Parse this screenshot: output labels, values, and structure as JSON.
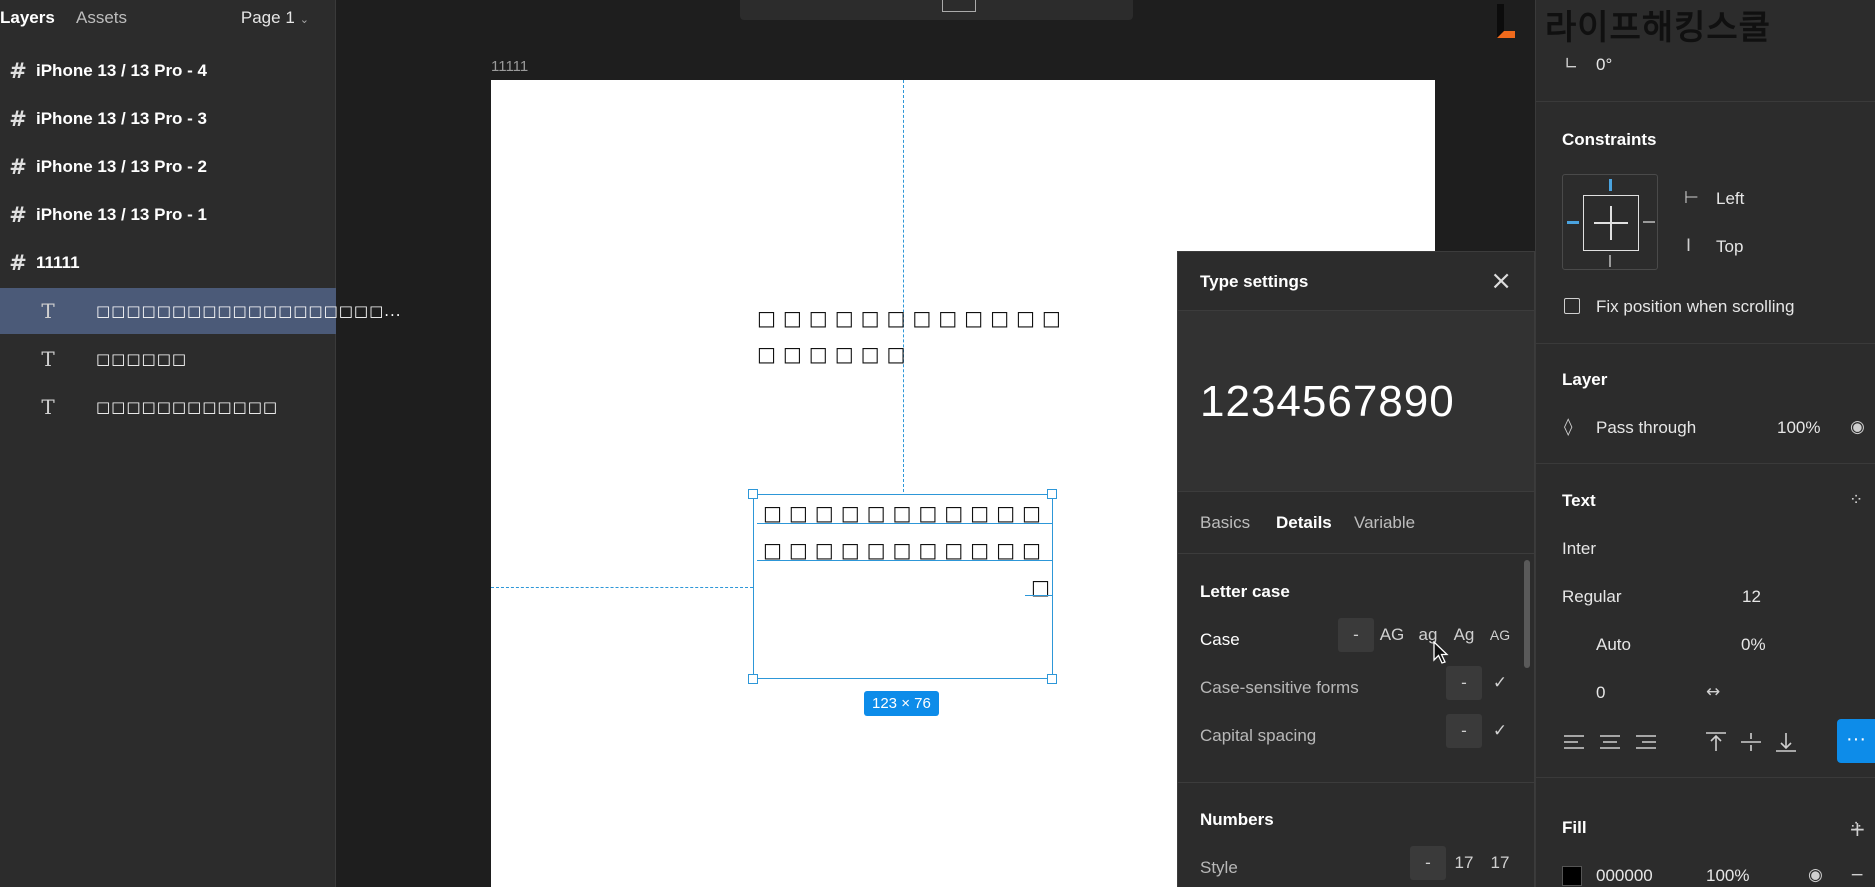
{
  "left_panel": {
    "tabs": {
      "layers": "Layers",
      "assets": "Assets"
    },
    "page_selector": "Page 1",
    "frame_icon": "#",
    "text_icon": "T",
    "layers": [
      {
        "type": "frame",
        "name": "iPhone 13 / 13 Pro - 4"
      },
      {
        "type": "frame",
        "name": "iPhone 13 / 13 Pro - 3"
      },
      {
        "type": "frame",
        "name": "iPhone 13 / 13 Pro - 2"
      },
      {
        "type": "frame",
        "name": "iPhone 13 / 13 Pro - 1"
      },
      {
        "type": "frame",
        "name": "11111"
      },
      {
        "type": "text",
        "name": "□□□□□□□□□□□□□□□□□□□...",
        "selected": true
      },
      {
        "type": "text",
        "name": "□□□□□□"
      },
      {
        "type": "text",
        "name": "□□□□□□□□□□□□"
      }
    ]
  },
  "canvas": {
    "frame_label": "11111",
    "text_block_1": {
      "line1": "□□□□□□□□□□□□",
      "line2": "□□□□□□"
    },
    "selected_text": {
      "line1": "□□□□□□□□□□□",
      "line2": "□□□□□□□□□□□",
      "line3": "□"
    },
    "dimension_badge": "123 × 76",
    "guide_color": "#2d97d8"
  },
  "type_settings": {
    "title": "Type settings",
    "close_icon": "×",
    "preview_text": "1234567890",
    "tabs": [
      "Basics",
      "Details",
      "Variable"
    ],
    "active_tab": "Details",
    "letter_case": {
      "title": "Letter case",
      "case_label": "Case",
      "case_options": [
        "-",
        "AG",
        "ag",
        "Ag",
        "AG"
      ],
      "case_sensitive_label": "Case-sensitive forms",
      "capital_spacing_label": "Capital spacing",
      "toggle_off": "-",
      "toggle_on": "✓"
    },
    "numbers": {
      "title": "Numbers",
      "style_label": "Style",
      "style_options": [
        "-",
        "17",
        "17"
      ]
    }
  },
  "design_panel": {
    "brand_text": "라이프해킹스쿨",
    "rotation": "0°",
    "rotation_icon": "∟",
    "constraints": {
      "title": "Constraints",
      "horizontal": "Left",
      "vertical": "Top",
      "h_icon": "⊢",
      "v_icon": "I"
    },
    "fix_position_label": "Fix position when scrolling",
    "layer": {
      "title": "Layer",
      "blend": "Pass through",
      "opacity": "100%",
      "drop_icon": "◊",
      "eye_icon": "◉"
    },
    "text": {
      "title": "Text",
      "font": "Inter",
      "weight": "Regular",
      "size": "12",
      "line_height": "Auto",
      "letter_spacing": "0%",
      "paragraph_spacing": "0",
      "auto_width_icon": "↔",
      "more_icon": "···",
      "grid_icon": "⁘"
    },
    "fill": {
      "title": "Fill",
      "hex": "000000",
      "opacity": "100%",
      "color": "#000000",
      "add_icon": "+",
      "remove_icon": "−"
    },
    "accent": "#0d8ce9"
  }
}
